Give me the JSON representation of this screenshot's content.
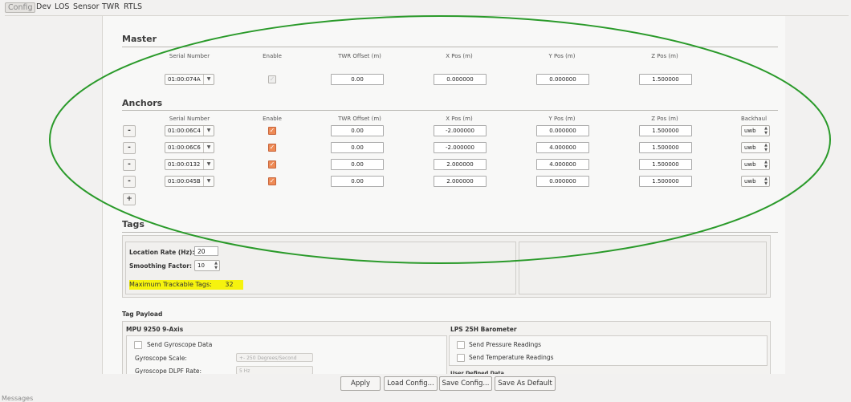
{
  "menu": {
    "items": [
      "Config",
      "Dev",
      "LOS",
      "Sensor",
      "TWR",
      "RTLS"
    ]
  },
  "master": {
    "title": "Master",
    "headers": {
      "serial": "Serial Number",
      "enable": "Enable",
      "twr": "TWR Offset (m)",
      "x": "X Pos (m)",
      "y": "Y Pos (m)",
      "z": "Z Pos (m)"
    },
    "row": {
      "serial": "01:00:074A",
      "enabled": true,
      "twr": "0.00",
      "x": "0.000000",
      "y": "0.000000",
      "z": "1.500000"
    }
  },
  "anchors": {
    "title": "Anchors",
    "headers": {
      "serial": "Serial Number",
      "enable": "Enable",
      "twr": "TWR Offset (m)",
      "x": "X Pos (m)",
      "y": "Y Pos (m)",
      "z": "Z Pos (m)",
      "backhaul": "Backhaul"
    },
    "remove_label": "-",
    "add_label": "+",
    "rows": [
      {
        "serial": "01:00:06C4",
        "enabled": true,
        "twr": "0.00",
        "x": "-2.000000",
        "y": "0.000000",
        "z": "1.500000",
        "backhaul": "uwb"
      },
      {
        "serial": "01:00:06C6",
        "enabled": true,
        "twr": "0.00",
        "x": "-2.000000",
        "y": "4.000000",
        "z": "1.500000",
        "backhaul": "uwb"
      },
      {
        "serial": "01:00:0132",
        "enabled": true,
        "twr": "0.00",
        "x": "2.000000",
        "y": "4.000000",
        "z": "1.500000",
        "backhaul": "uwb"
      },
      {
        "serial": "01:00:045B",
        "enabled": true,
        "twr": "0.00",
        "x": "2.000000",
        "y": "0.000000",
        "z": "1.500000",
        "backhaul": "uwb"
      }
    ]
  },
  "tags": {
    "title": "Tags",
    "location_rate_label": "Location Rate (Hz):",
    "location_rate_value": "20",
    "smoothing_label": "Smoothing Factor:",
    "smoothing_value": "10",
    "max_tags_label": "Maximum Trackable Tags:",
    "max_tags_value": "32"
  },
  "payload": {
    "title": "Tag Payload",
    "mpu_title": "MPU 9250 9-Axis",
    "send_gyro_label": "Send Gyroscope Data",
    "gyro_scale_label": "Gyroscope Scale:",
    "gyro_scale_value": "+- 250 Degrees/Second",
    "gyro_dlpf_label": "Gyroscope DLPF Rate:",
    "gyro_dlpf_value": "5 Hz",
    "lps_title": "LPS 25H Barometer",
    "send_pressure_label": "Send Pressure Readings",
    "send_temp_label": "Send Temperature Readings",
    "user_defined_label": "User Defined Data"
  },
  "buttons": {
    "apply": "Apply",
    "load": "Load Config...",
    "save": "Save Config...",
    "default": "Save As Default"
  },
  "messages_label": "Messages",
  "colors": {
    "annotation": "#2a9a2a",
    "highlight": "#f6f30e",
    "checkbox_on": "#ee8a55"
  }
}
